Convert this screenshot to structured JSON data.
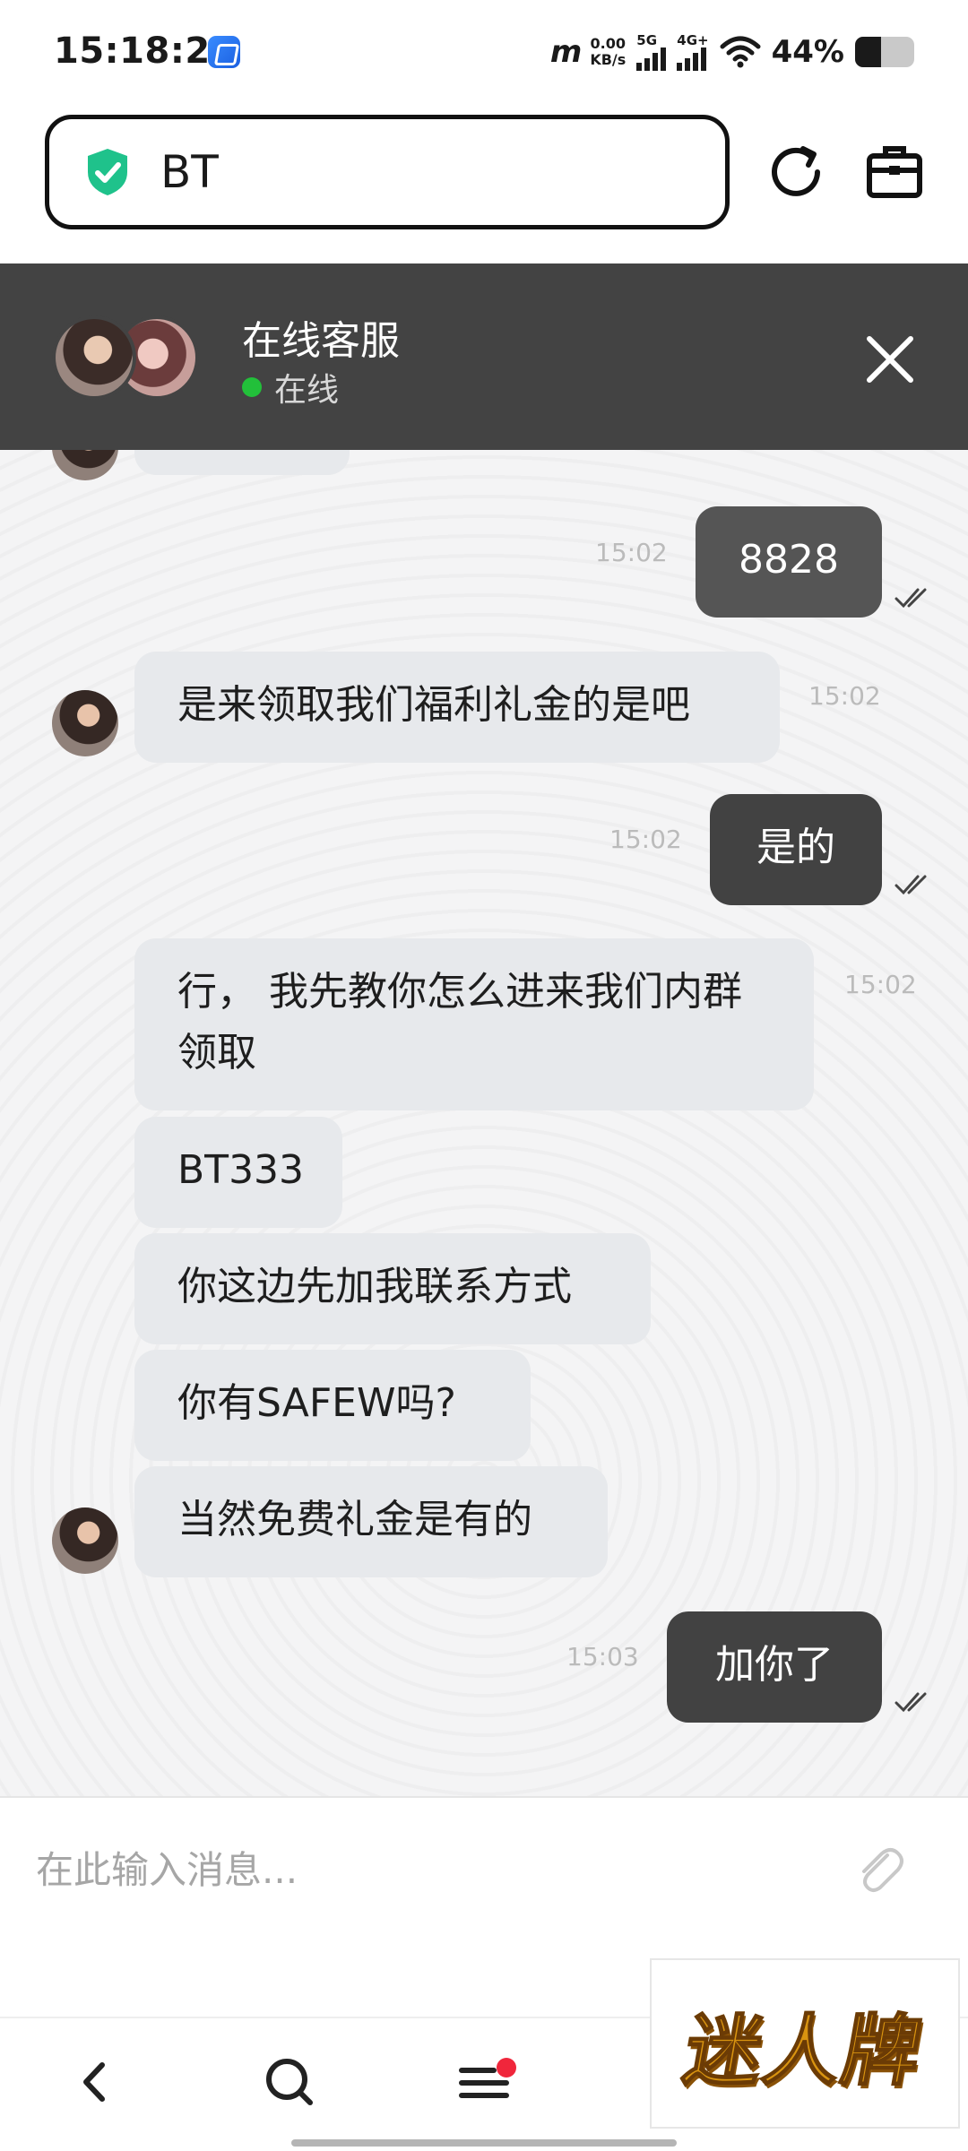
{
  "status_bar": {
    "time": "15:18:27",
    "carrier": "m",
    "speed_value": "0.00",
    "speed_unit": "KB/s",
    "sig1_label": "5G",
    "sig2_label": "4G+",
    "battery": "44%",
    "battery_level": 0.44
  },
  "browser": {
    "url": "BT",
    "secure_icon": "shield-check-icon",
    "reload_icon": "reload-icon",
    "toolbox_icon": "briefcase-icon"
  },
  "chat_header": {
    "name": "在线客服",
    "status": "在线",
    "close_icon": "close-icon",
    "online_color": "#22c03a"
  },
  "messages": {
    "m1": {
      "text": "8828",
      "time": "15:02"
    },
    "m2": {
      "text": "是来领取我们福利礼金的是吧",
      "time": "15:02"
    },
    "m3": {
      "text": "是的",
      "time": "15:02"
    },
    "m4": {
      "text": "行， 我先教你怎么进来我们内群领取",
      "time": "15:02"
    },
    "m5": {
      "text": "BT333"
    },
    "m6": {
      "text": "你这边先加我联系方式"
    },
    "m7": {
      "text": "你有SAFEW吗?"
    },
    "m8": {
      "text": "当然免费礼金是有的"
    },
    "m9": {
      "text": "加你了",
      "time": "15:03"
    }
  },
  "composer": {
    "placeholder": "在此输入消息...",
    "attach_icon": "paperclip-icon"
  },
  "nav": {
    "back_icon": "back-icon",
    "search_icon": "search-icon",
    "menu_icon": "menu-icon"
  },
  "brand": {
    "text": "迷人牌"
  },
  "colors": {
    "header_bg": "#434343",
    "out_bubble": "#424242",
    "in_bubble": "#e7e9ec",
    "secure_green": "#1fc28b"
  }
}
